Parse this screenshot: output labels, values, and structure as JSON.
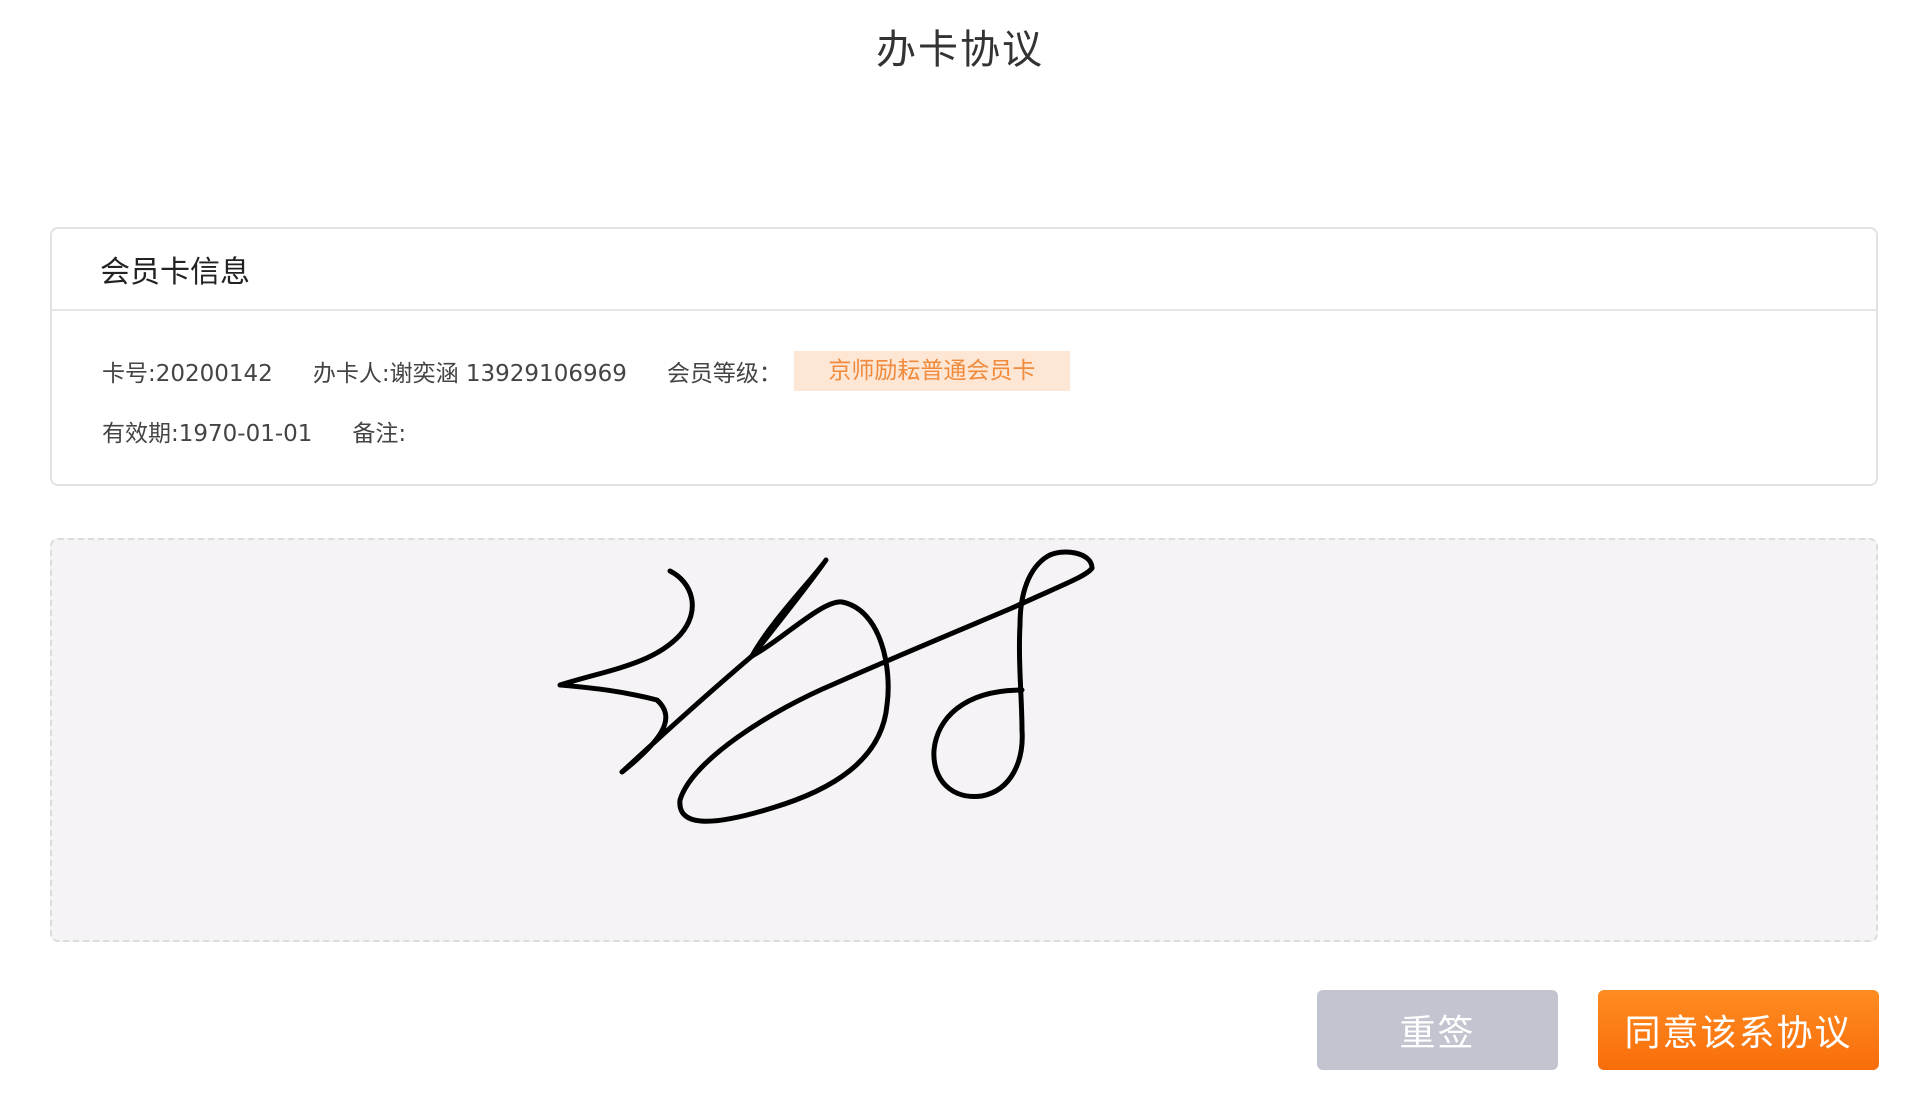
{
  "page": {
    "title": "办卡协议"
  },
  "card_info": {
    "title": "会员卡信息",
    "card_no": "卡号:20200142",
    "handler": "办卡人:谢奕涵 13929106969",
    "level_label": "会员等级：",
    "level_value": "京师励耘普通会员卡",
    "expiry": "有效期:1970-01-01",
    "remark": "备注:"
  },
  "colors": {
    "accent": "#f86d0a",
    "badge_bg": "#fde6d4",
    "badge_text": "#f08a3c",
    "resign_button": "#c2c5cf",
    "signature_bg": "#f6f3f6"
  },
  "actions": {
    "resign_label": "重签",
    "agree_label": "同意该系协议"
  }
}
